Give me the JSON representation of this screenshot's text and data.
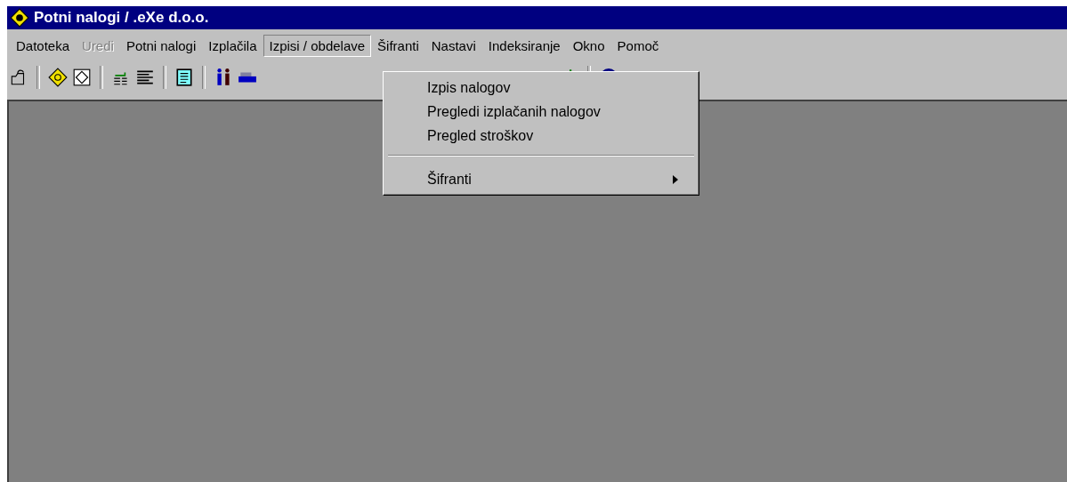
{
  "window": {
    "title": "Potni nalogi / .eXe d.o.o."
  },
  "menu_bar": [
    {
      "label": "Datoteka",
      "disabled": false,
      "selected": false
    },
    {
      "label": "Uredi",
      "disabled": true,
      "selected": false
    },
    {
      "label": "Potni nalogi",
      "disabled": false,
      "selected": false
    },
    {
      "label": "Izplačila",
      "disabled": false,
      "selected": false
    },
    {
      "label": "Izpisi / obdelave",
      "disabled": false,
      "selected": true
    },
    {
      "label": "Šifranti",
      "disabled": false,
      "selected": false
    },
    {
      "label": "Nastavi",
      "disabled": false,
      "selected": false
    },
    {
      "label": "Indeksiranje",
      "disabled": false,
      "selected": false
    },
    {
      "label": "Okno",
      "disabled": false,
      "selected": false
    },
    {
      "label": "Pomoč",
      "disabled": false,
      "selected": false
    }
  ],
  "dropdown": [
    {
      "kind": "item",
      "label": "Izpis nalogov"
    },
    {
      "kind": "item",
      "label": "Pregledi izplačanih nalogov"
    },
    {
      "kind": "item",
      "label": "Pregled stroškov"
    },
    {
      "kind": "separator"
    },
    {
      "kind": "submenu",
      "label": "Šifranti"
    }
  ]
}
